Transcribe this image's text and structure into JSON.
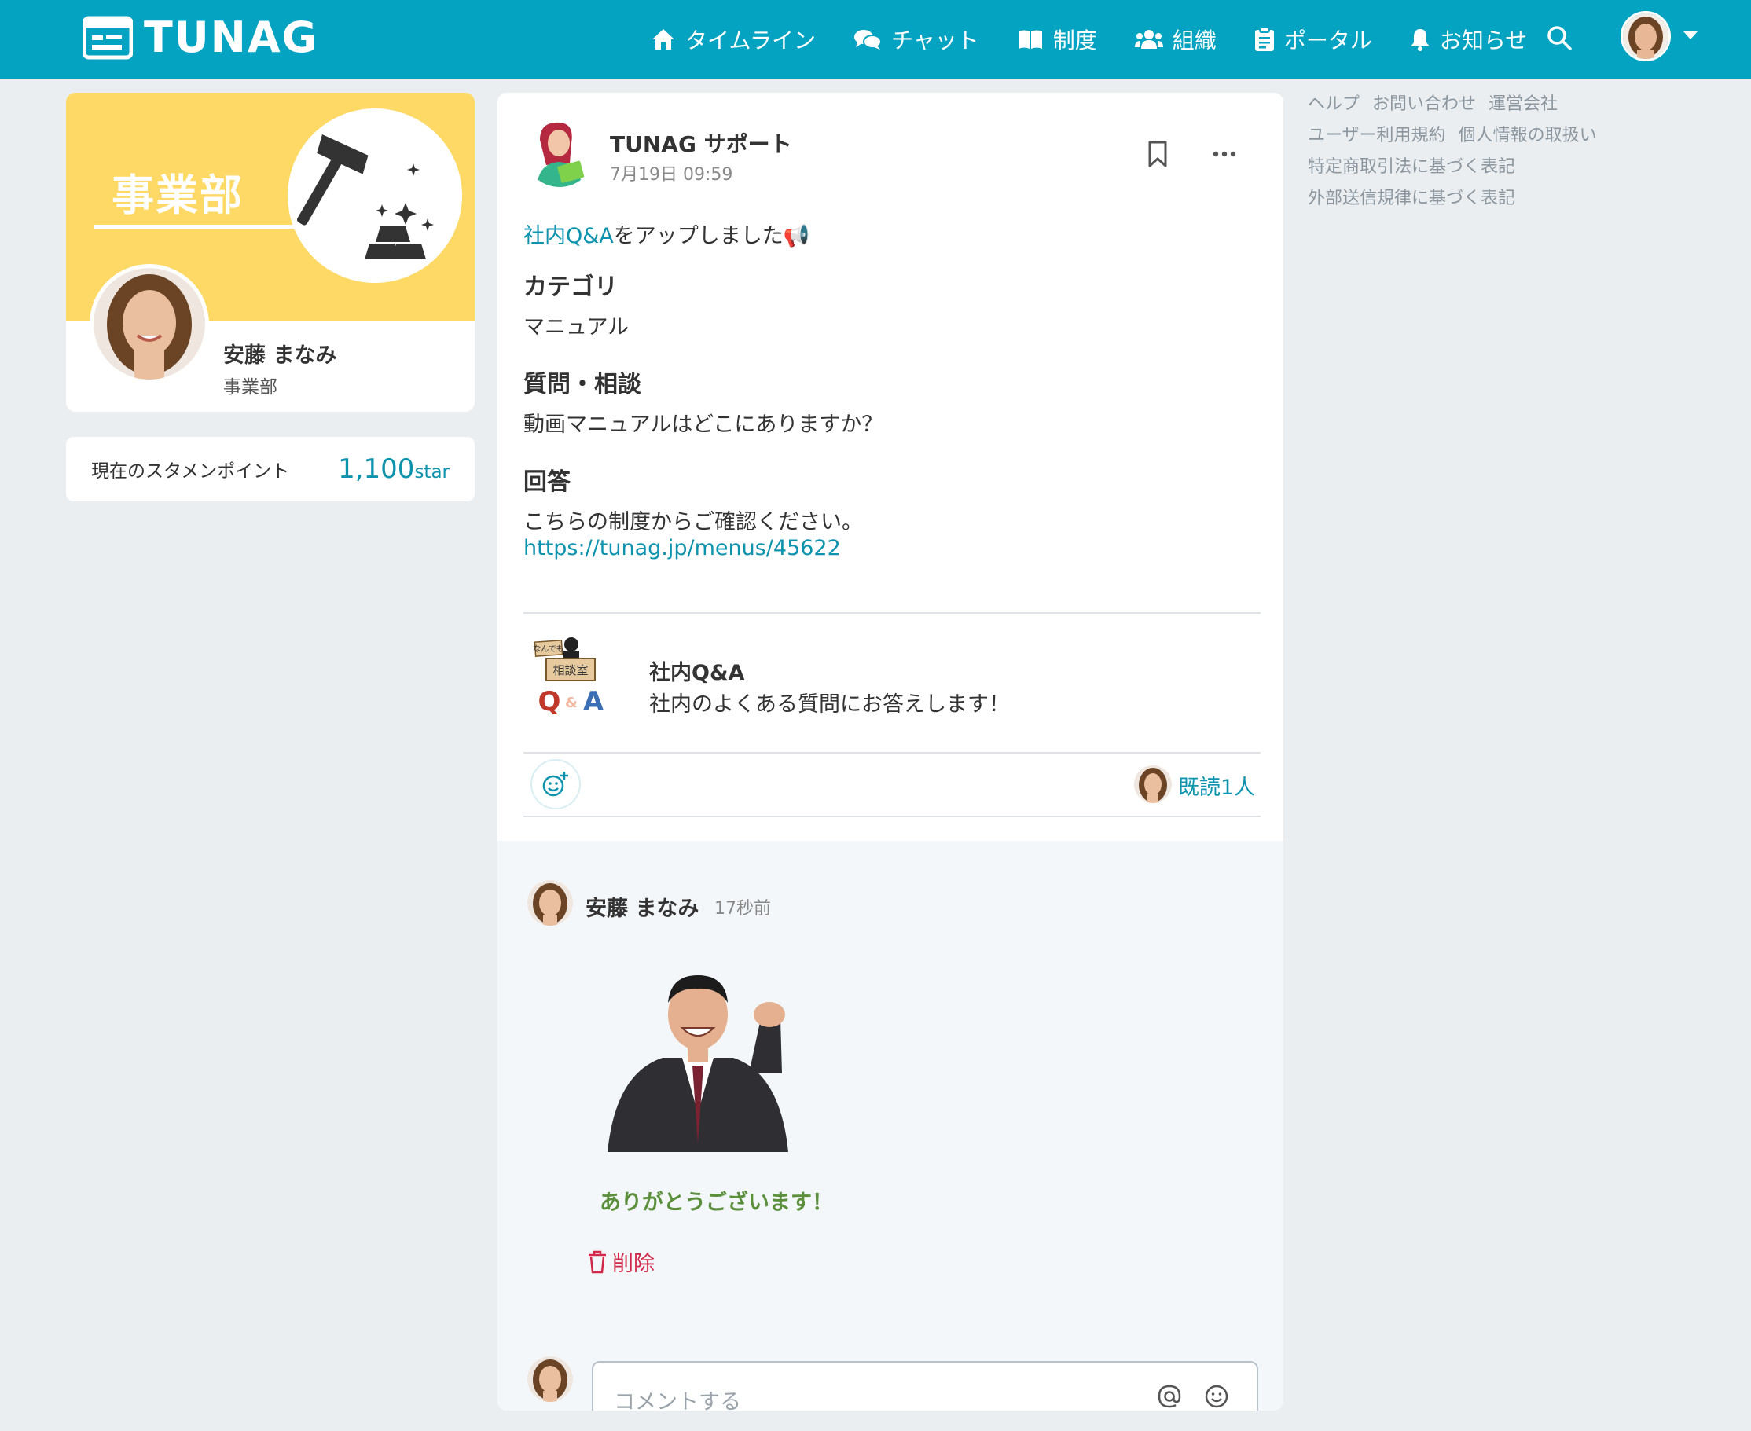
{
  "header": {
    "brand": "TUNAG",
    "nav": [
      {
        "label": "タイムライン",
        "icon": "home-icon"
      },
      {
        "label": "チャット",
        "icon": "chat-icon"
      },
      {
        "label": "制度",
        "icon": "book-icon"
      },
      {
        "label": "組織",
        "icon": "people-icon"
      },
      {
        "label": "ポータル",
        "icon": "clipboard-icon"
      },
      {
        "label": "お知らせ",
        "icon": "bell-icon"
      }
    ]
  },
  "profile": {
    "department_banner": "事業部",
    "name": "安藤 まなみ",
    "department": "事業部"
  },
  "points": {
    "label": "現在のスタメンポイント",
    "value": "1,100",
    "unit": "star"
  },
  "post": {
    "author": "TUNAG サポート",
    "time": "7月19日 09:59",
    "lead_link": "社内Q&A",
    "lead_text": "をアップしました📢",
    "sections": [
      {
        "heading": "カテゴリ",
        "body": "マニュアル"
      },
      {
        "heading": "質問・相談",
        "body": "動画マニュアルはどこにありますか？"
      },
      {
        "heading": "回答",
        "body": "こちらの制度からご確認ください。"
      }
    ],
    "url": "https://tunag.jp/menus/45622",
    "attachment": {
      "title": "社内Q&A",
      "description": "社内のよくある質問にお答えします！",
      "thumb_sign": "相談室",
      "thumb_top": "なんでも",
      "thumb_q": "Q",
      "thumb_amp": "&",
      "thumb_a": "A"
    },
    "read_count": "既読1人"
  },
  "comment": {
    "author": "安藤 まなみ",
    "time": "17秒前",
    "sticker_text": "ありがとうございます！",
    "delete_label": "削除"
  },
  "comment_input": {
    "placeholder": "コメントする"
  },
  "footer_links": [
    [
      "ヘルプ",
      "お問い合わせ",
      "運営会社"
    ],
    [
      "ユーザー利用規約",
      "個人情報の取扱い"
    ],
    [
      "特定商取引法に基づく表記"
    ],
    [
      "外部送信規律に基づく表記"
    ]
  ],
  "colors": {
    "header": "#03a3c1",
    "accent": "#0d93ad",
    "banner": "#ffd966",
    "danger": "#d0294a"
  }
}
